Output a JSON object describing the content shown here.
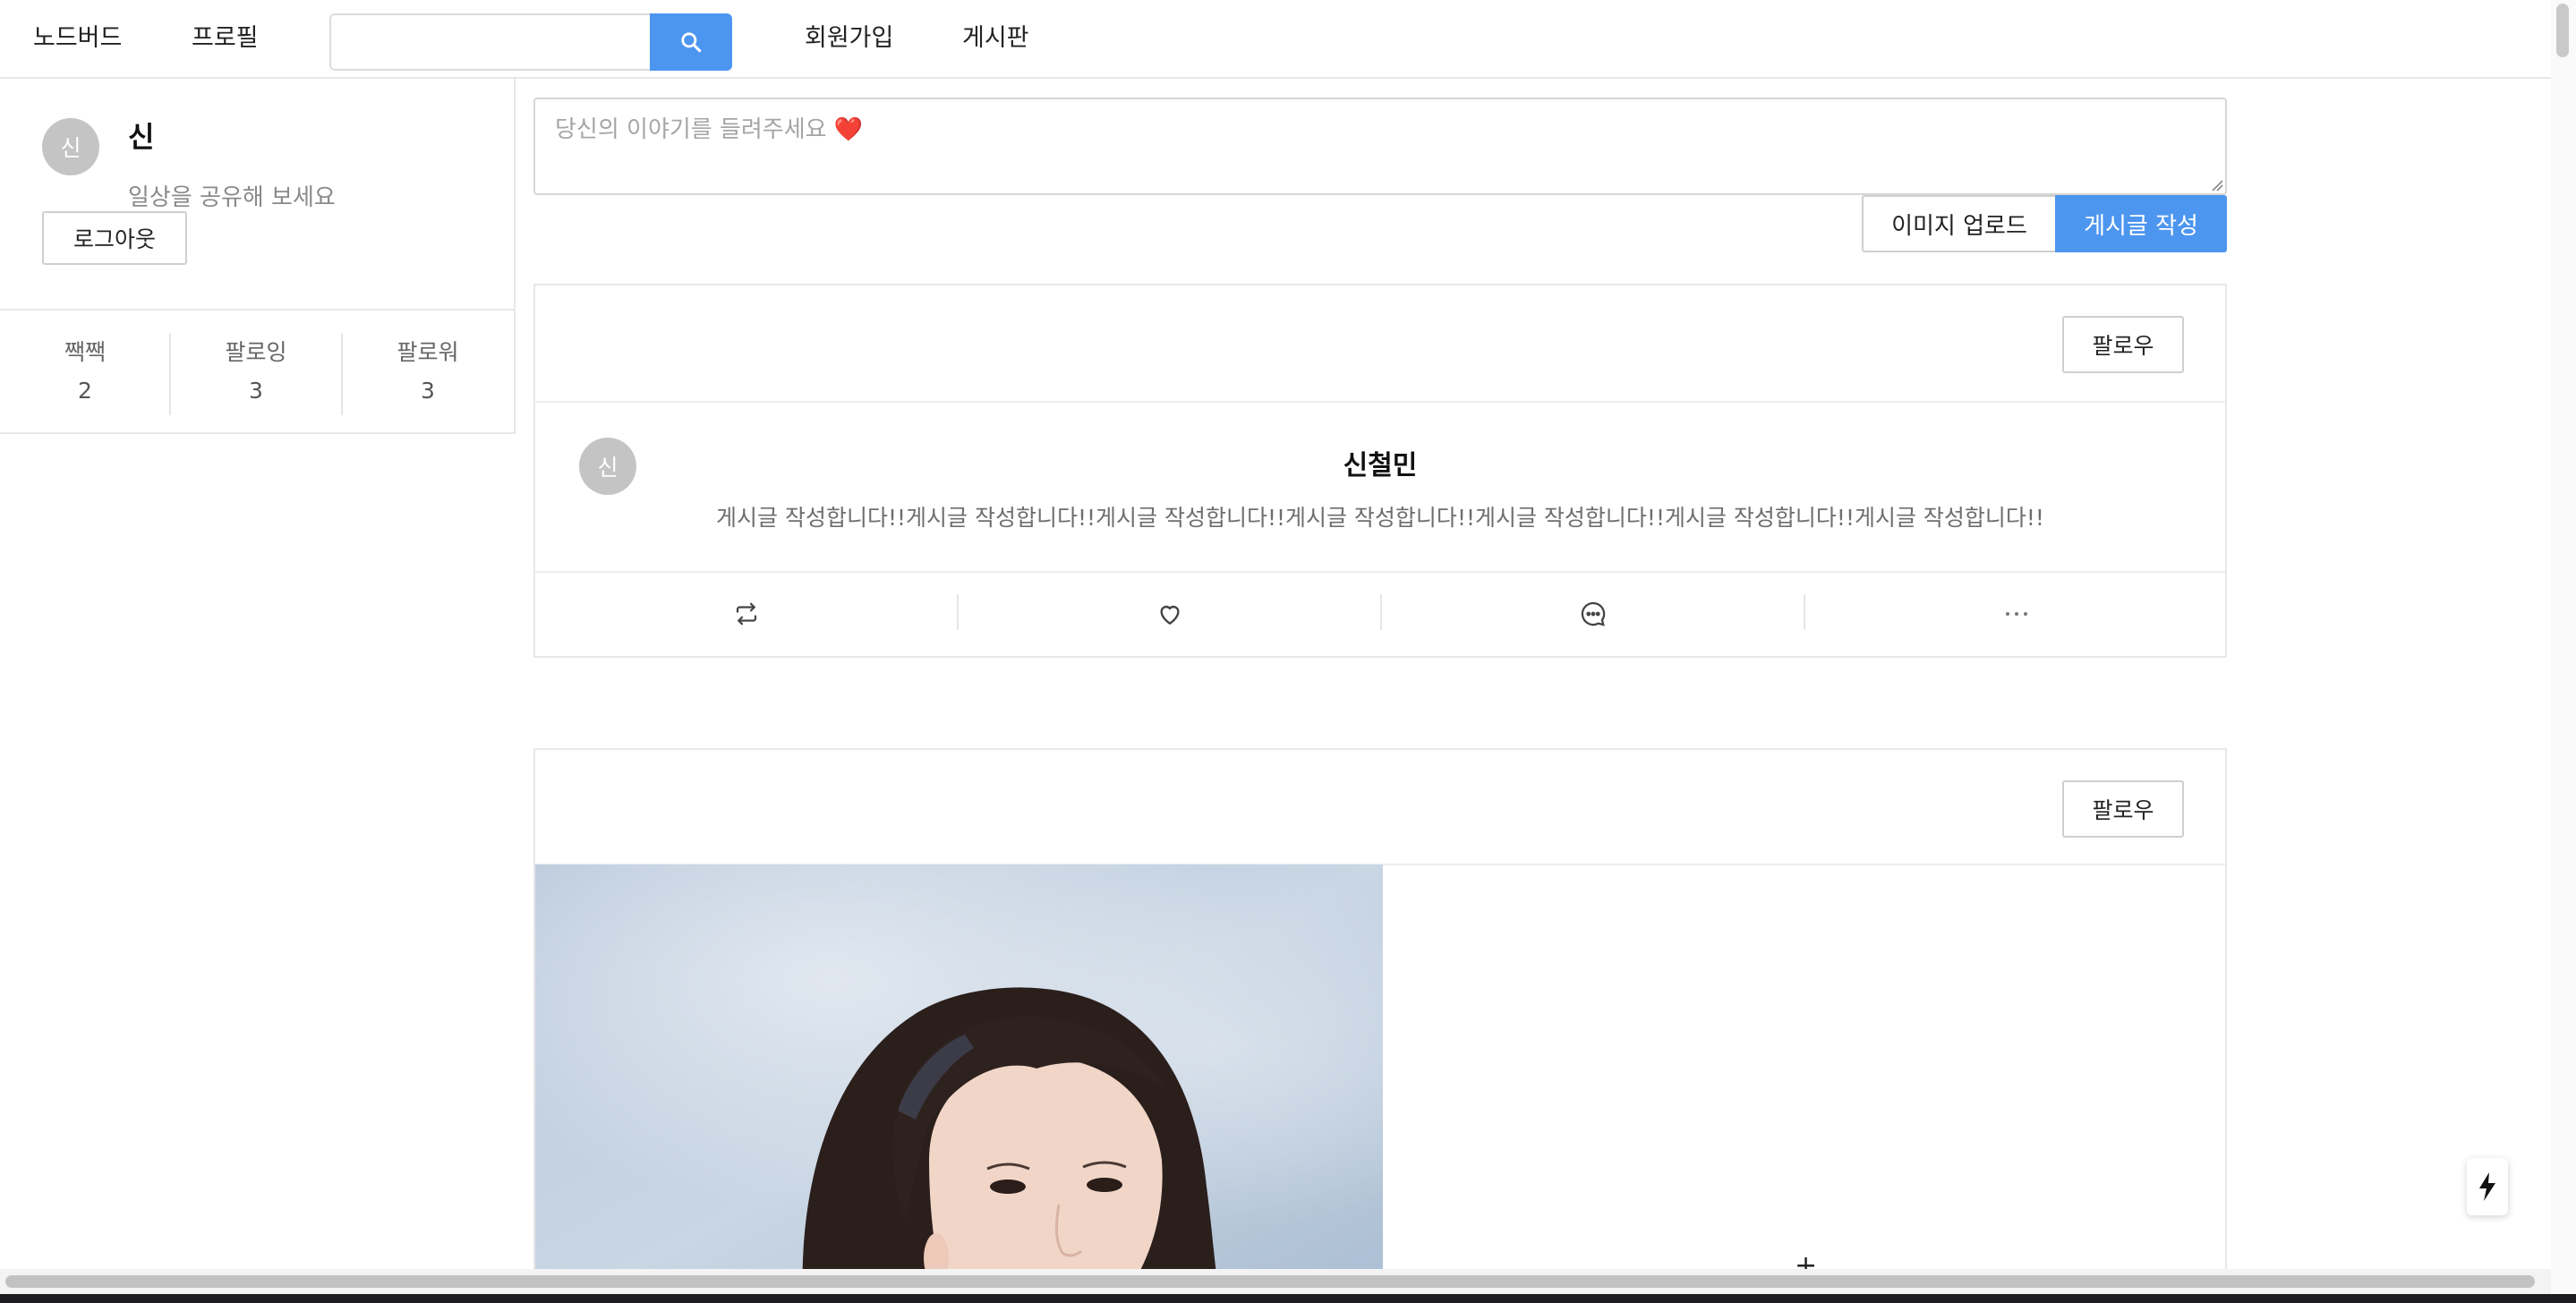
{
  "nav": {
    "brand": "노드버드",
    "profile_link": "프로필",
    "search": {
      "value": "",
      "placeholder": ""
    },
    "signup_link": "회원가입",
    "board_link": "게시판",
    "search_icon": "search-icon"
  },
  "sidebar": {
    "avatar_initial": "신",
    "name": "신",
    "description": "일상을 공유해 보세요",
    "logout_label": "로그아웃",
    "stats": [
      {
        "label": "짹짹",
        "value": "2"
      },
      {
        "label": "팔로잉",
        "value": "3"
      },
      {
        "label": "팔로워",
        "value": "3"
      }
    ]
  },
  "composer": {
    "placeholder": "당신의 이야기를 들려주세요",
    "placeholder_emoji": "❤️",
    "upload_label": "이미지 업로드",
    "submit_label": "게시글 작성"
  },
  "posts": [
    {
      "follow_label": "팔로우",
      "avatar_initial": "신",
      "author": "신철민",
      "content": "게시글 작성합니다!!게시글 작성합니다!!게시글 작성합니다!!게시글 작성합니다!!게시글 작성합니다!!게시글 작성합니다!!게시글 작성합니다!!",
      "actions": [
        "retweet-icon",
        "heart-icon",
        "comment-icon",
        "more-icon"
      ]
    },
    {
      "follow_label": "팔로우",
      "image": "photo of a woman with dark wavy hair and a hair ribbon against a cloudy blue sky"
    }
  ],
  "colors": {
    "primary": "#4d96ef",
    "border": "#e8e8e8",
    "avatar_bg": "#c4c4c4",
    "muted_text": "#8a8a8a"
  }
}
